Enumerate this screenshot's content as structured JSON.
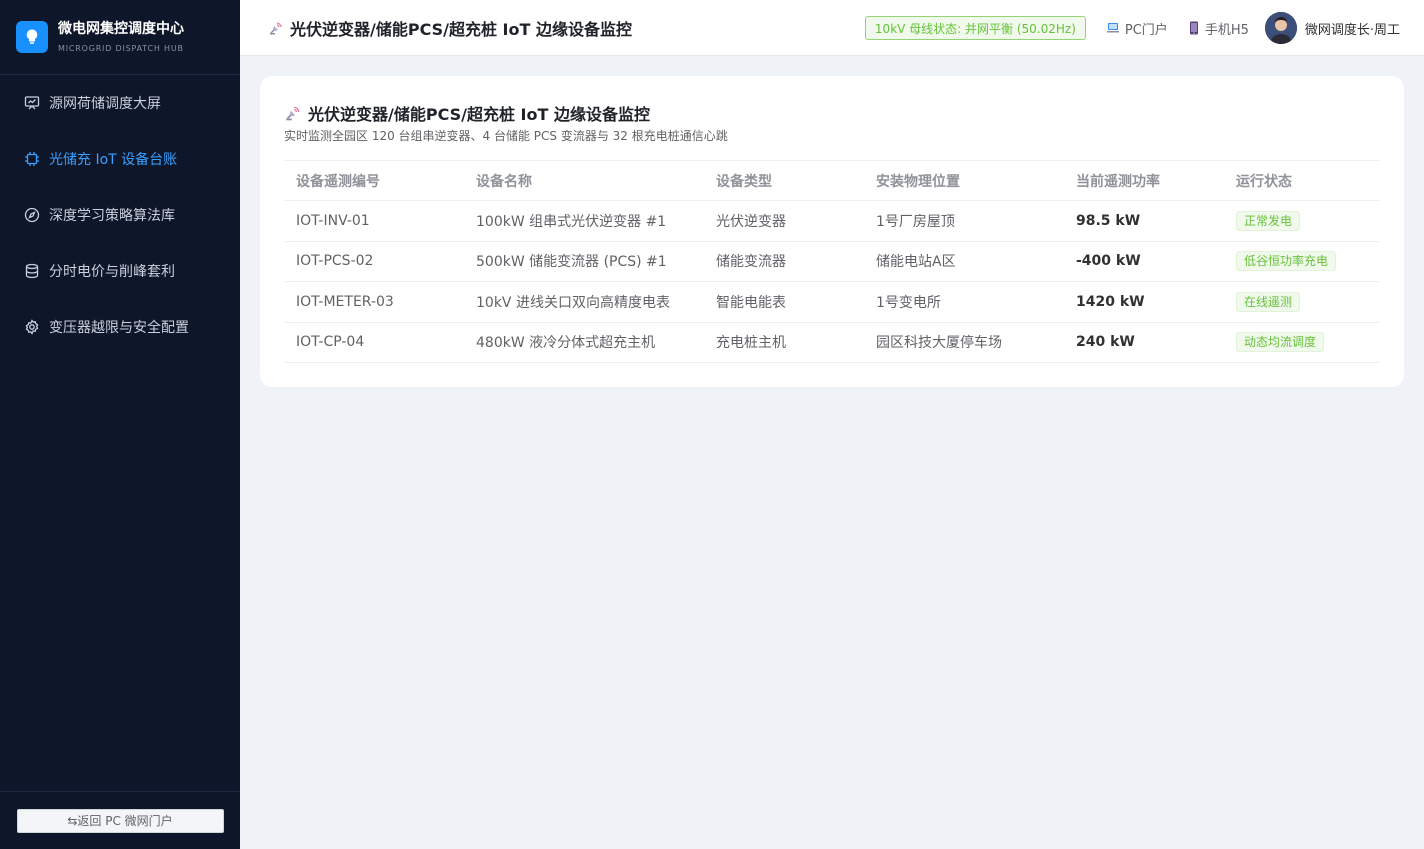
{
  "brand": {
    "title": "微电网集控调度中心",
    "subtitle": "MICROGRID DISPATCH HUB",
    "logo_icon": "lightbulb-icon",
    "accent": "#1890ff"
  },
  "sidebar": {
    "items": [
      {
        "label": "源网荷储调度大屏",
        "icon": "dashboard-screen-icon",
        "active": false
      },
      {
        "label": "光储充 IoT 设备台账",
        "icon": "chip-icon",
        "active": true
      },
      {
        "label": "深度学习策略算法库",
        "icon": "compass-icon",
        "active": false
      },
      {
        "label": "分时电价与削峰套利",
        "icon": "database-icon",
        "active": false
      },
      {
        "label": "变压器越限与安全配置",
        "icon": "gear-icon",
        "active": false
      }
    ],
    "return_label": "⇆返回 PC 微网门户"
  },
  "header": {
    "title": "光伏逆变器/储能PCS/超充桩 IoT 边缘设备监控",
    "title_icon": "satellite-icon",
    "bus_status": "10kV 母线状态: 并网平衡 (50.02Hz)",
    "pc_link": "PC门户",
    "pc_icon": "laptop-icon",
    "mobile_link": "手机H5",
    "mobile_icon": "mobile-icon",
    "user_name": "微网调度长·周工"
  },
  "card": {
    "title": "光伏逆变器/储能PCS/超充桩 IoT 边缘设备监控",
    "subtitle": "实时监测全园区 120 台组串逆变器、4 台储能 PCS 变流器与 32 根充电桩通信心跳"
  },
  "table": {
    "headers": [
      "设备遥测编号",
      "设备名称",
      "设备类型",
      "安装物理位置",
      "当前遥测功率",
      "运行状态"
    ],
    "rows": [
      {
        "id": "IOT-INV-01",
        "name": "100kW 组串式光伏逆变器 #1",
        "type": "光伏逆变器",
        "location": "1号厂房屋顶",
        "power": "98.5 kW",
        "status": "正常发电"
      },
      {
        "id": "IOT-PCS-02",
        "name": "500kW 储能变流器 (PCS) #1",
        "type": "储能变流器",
        "location": "储能电站A区",
        "power": "-400 kW",
        "status": "低谷恒功率充电"
      },
      {
        "id": "IOT-METER-03",
        "name": "10kV 进线关口双向高精度电表",
        "type": "智能电能表",
        "location": "1号变电所",
        "power": "1420 kW",
        "status": "在线遥测"
      },
      {
        "id": "IOT-CP-04",
        "name": "480kW 液冷分体式超充主机",
        "type": "充电桩主机",
        "location": "园区科技大厦停车场",
        "power": "240 kW",
        "status": "动态均流调度"
      }
    ]
  },
  "colors": {
    "sidebar_bg": "#0e1629",
    "active": "#3aa0ff",
    "status_green": "#67c23a"
  }
}
